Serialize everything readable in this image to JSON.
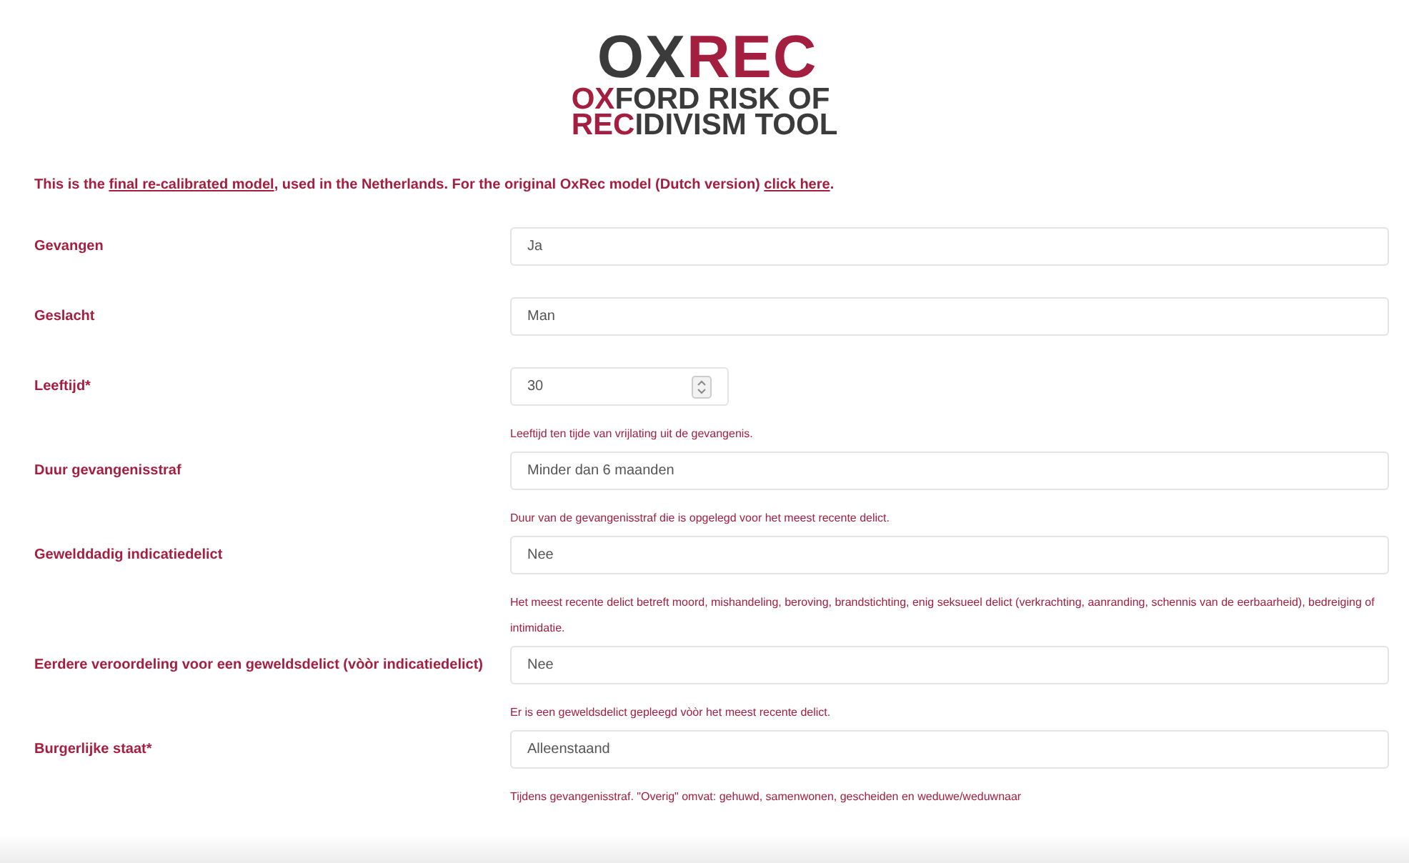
{
  "logo": {
    "lines": [
      [
        {
          "text": "OX",
          "accent": false
        },
        {
          "text": "REC",
          "accent": true
        }
      ],
      [
        {
          "text": "OX",
          "accent": true
        },
        {
          "text": "FORD RISK OF",
          "accent": false
        }
      ],
      [
        {
          "text": "REC",
          "accent": true
        },
        {
          "text": "IDIVISM TOOL",
          "accent": false
        }
      ]
    ]
  },
  "intro": [
    {
      "kind": "text",
      "text": "This is the "
    },
    {
      "kind": "link",
      "text": "final re-calibrated model"
    },
    {
      "kind": "text",
      "text": ", used in the Netherlands. For the original OxRec model (Dutch version) "
    },
    {
      "kind": "link",
      "text": "click here"
    },
    {
      "kind": "text",
      "text": "."
    }
  ],
  "fields": [
    {
      "label": "Gevangen",
      "kind": "select",
      "value": "Ja"
    },
    {
      "label": "Geslacht",
      "kind": "select",
      "value": "Man"
    },
    {
      "label": "Leeftijd*",
      "kind": "number",
      "value": "30",
      "help": "Leeftijd ten tijde van vrijlating uit de gevangenis."
    },
    {
      "label": "Duur gevangenisstraf",
      "kind": "select",
      "value": "Minder dan 6 maanden",
      "help": "Duur van de gevangenisstraf die is opgelegd voor het meest recente delict."
    },
    {
      "label": "Gewelddadig indicatiedelict",
      "kind": "select",
      "value": "Nee",
      "help": "Het meest recente delict betreft moord, mishandeling, beroving, brandstichting, enig seksueel delict (verkrachting, aanranding, schennis van de eerbaarheid), bedreiging of intimidatie."
    },
    {
      "label": "Eerdere veroordeling voor een geweldsdelict (vòòr indicatiedelict)",
      "kind": "select",
      "value": "Nee",
      "help": "Er is een geweldsdelict gepleegd vòòr het meest recente delict."
    },
    {
      "label": "Burgerlijke staat*",
      "kind": "select",
      "value": "Alleenstaand",
      "help": "Tijdens gevangenisstraf. \"Overig\" omvat: gehuwd, samenwonen, gescheiden en weduwe/weduwnaar"
    }
  ]
}
